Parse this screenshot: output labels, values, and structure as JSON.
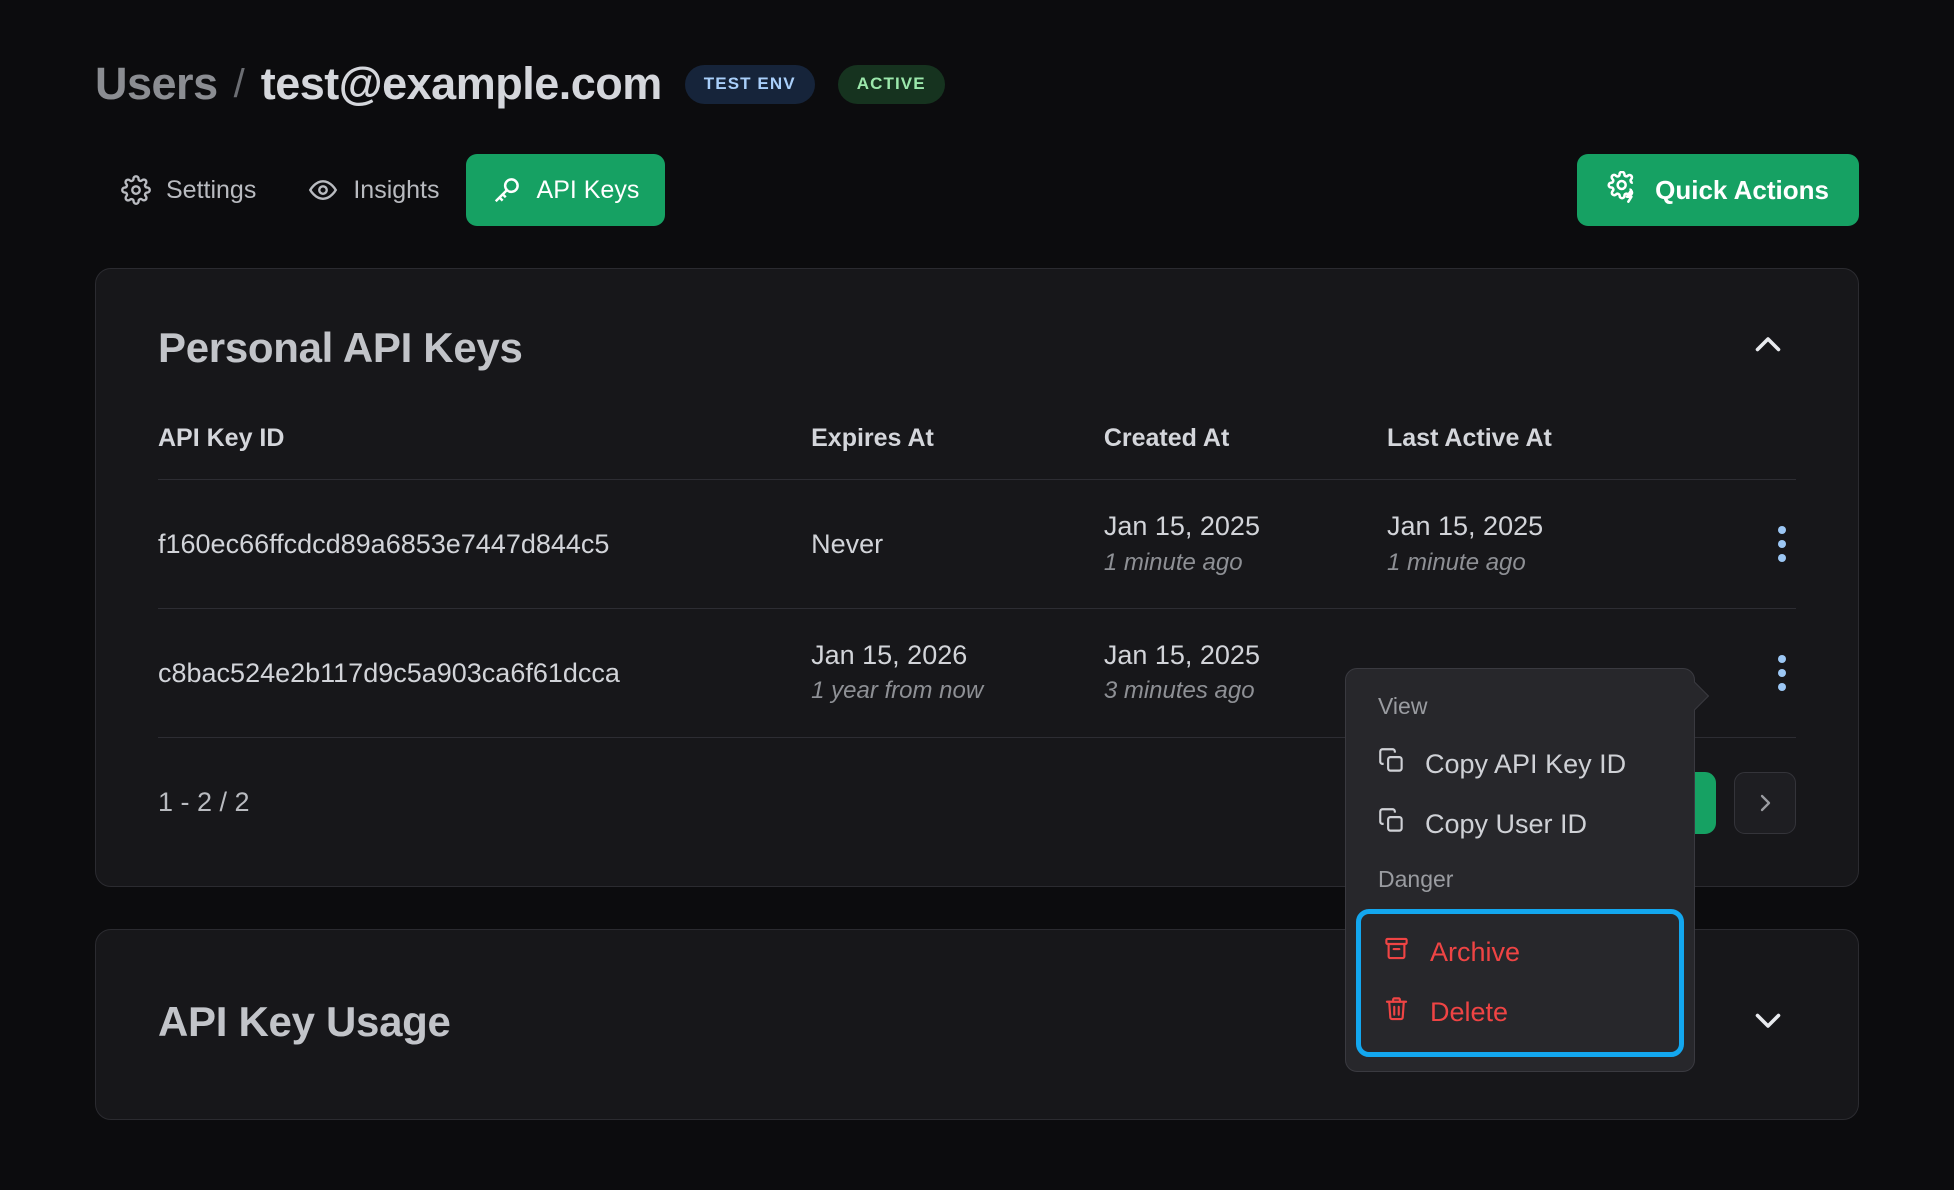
{
  "header": {
    "breadcrumb_root": "Users",
    "breadcrumb_separator": "/",
    "breadcrumb_current": "test@example.com",
    "badges": [
      {
        "label": "TEST ENV",
        "color": "#a9cffa",
        "bg": "#16243a"
      },
      {
        "label": "ACTIVE",
        "color": "#9be7ab",
        "bg": "#16331f"
      }
    ]
  },
  "tabs": [
    {
      "label": "Settings",
      "icon": "gear-icon",
      "active": false
    },
    {
      "label": "Insights",
      "icon": "eye-icon",
      "active": false
    },
    {
      "label": "API Keys",
      "icon": "key-icon",
      "active": true
    }
  ],
  "quick_actions": {
    "label": "Quick Actions",
    "icon": "gear-bolt-icon",
    "accent": "#16a163"
  },
  "api_keys_panel": {
    "title": "Personal API Keys",
    "collapse_icon": "chevron-up-icon",
    "columns": [
      "API Key ID",
      "Expires At",
      "Created At",
      "Last Active At"
    ],
    "rows": [
      {
        "id": "f160ec66ffcdcd89a6853e7447d844c5",
        "expires_at": "Never",
        "expires_rel": "",
        "created_at": "Jan 15, 2025",
        "created_rel": "1 minute ago",
        "last_active_at": "Jan 15, 2025",
        "last_active_rel": "1 minute ago"
      },
      {
        "id": "c8bac524e2b117d9c5a903ca6f61dcca",
        "expires_at": "Jan 15, 2026",
        "expires_rel": "1 year from now",
        "created_at": "Jan 15, 2025",
        "created_rel": "3 minutes ago",
        "last_active_at": "",
        "last_active_rel": ""
      }
    ],
    "pagination": {
      "range": "1 - 2 / 2",
      "prev_icon": "chevron-left-icon",
      "next_icon": "chevron-right-icon"
    }
  },
  "usage_panel": {
    "title": "API Key Usage",
    "expand_icon": "chevron-down-icon"
  },
  "context_menu": {
    "section_view_label": "View",
    "items": [
      {
        "label": "Copy API Key ID",
        "icon": "copy-icon"
      },
      {
        "label": "Copy User ID",
        "icon": "copy-icon"
      }
    ],
    "section_danger_label": "Danger",
    "danger_items": [
      {
        "label": "Archive",
        "icon": "archive-icon"
      },
      {
        "label": "Delete",
        "icon": "trash-icon"
      }
    ],
    "highlight_color": "#13a7ef",
    "danger_color": "#ef4444"
  }
}
